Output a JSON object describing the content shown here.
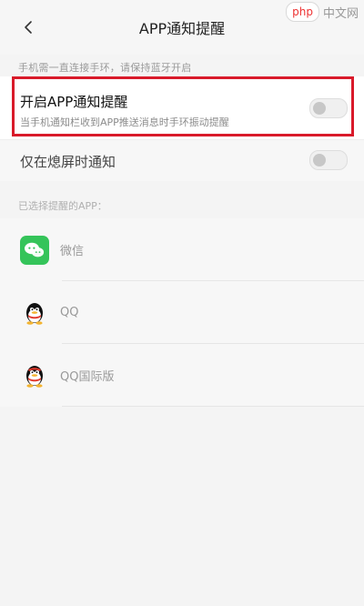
{
  "topbar": {
    "title": "APP通知提醒",
    "back_icon": "chevron-left-icon"
  },
  "watermark": {
    "badge": "php",
    "text": "中文网"
  },
  "notice": "手机需一直连接手环，请保持蓝牙开启",
  "settings": {
    "app_notify": {
      "title": "开启APP通知提醒",
      "subtitle": "当手机通知栏收到APP推送消息时手环振动提醒",
      "enabled": false
    },
    "screen_off_only": {
      "title": "仅在熄屏时通知",
      "enabled": false
    }
  },
  "apps_section_label": "已选择提醒的APP：",
  "apps": [
    {
      "name": "微信",
      "icon": "wechat-icon"
    },
    {
      "name": "QQ",
      "icon": "qq-icon"
    },
    {
      "name": "QQ国际版",
      "icon": "qq-international-icon"
    }
  ],
  "colors": {
    "highlight": "#d91a2a",
    "wechat": "#35c45a"
  }
}
